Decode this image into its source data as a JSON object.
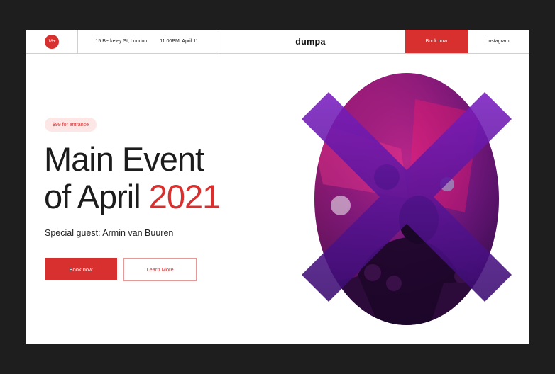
{
  "topbar": {
    "age_badge": "18+",
    "address": "15 Berkeley St, London",
    "datetime": "11:00PM, April 11",
    "logo": "dumpa",
    "book_label": "Book now",
    "instagram_label": "Instagram"
  },
  "hero": {
    "price_pill": "$99 for entrance",
    "title_line1": "Main Event",
    "title_line2_prefix": "of April ",
    "title_year": "2021",
    "guest": "Special guest: Armin van Buuren",
    "book_button": "Book now",
    "learn_button": "Learn More"
  },
  "colors": {
    "accent": "#d82f2f",
    "pill_bg": "#fde6e6",
    "frame_bg": "#1e1e1e"
  },
  "image": {
    "icon": "concert-crowd-photo"
  }
}
